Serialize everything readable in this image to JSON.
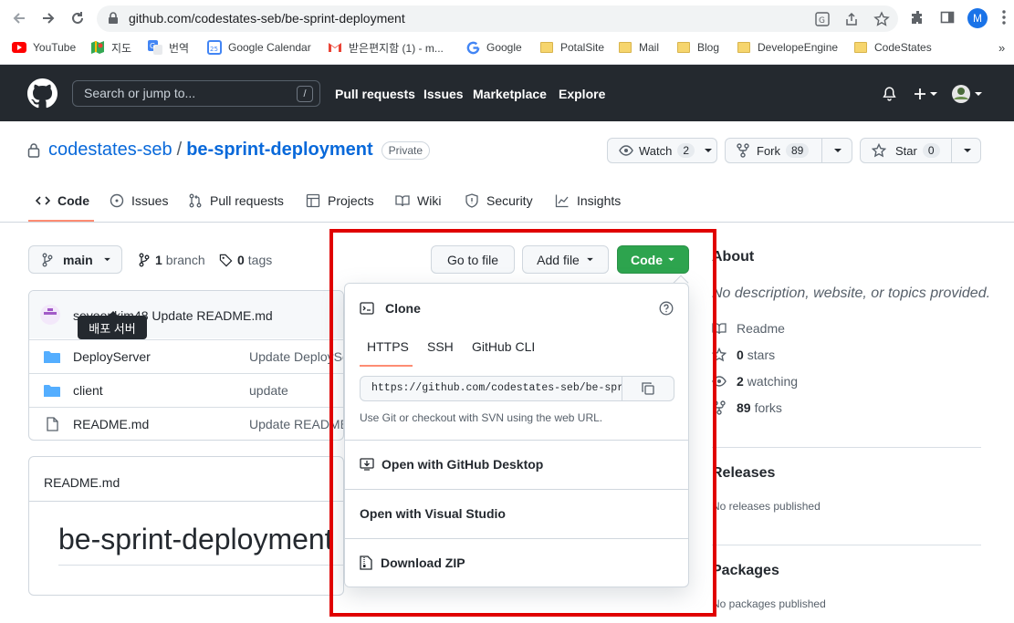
{
  "browser": {
    "url": "github.com/codestates-seb/be-sprint-deployment",
    "profile_initial": "M",
    "bookmarks": [
      "YouTube",
      "지도",
      "번역",
      "Google Calendar",
      "받은편지함 (1) - m...",
      "Google",
      "PotalSite",
      "Mail",
      "Blog",
      "DevelopeEngine",
      "CodeStates"
    ],
    "bookmarks_more": "»"
  },
  "header": {
    "search_placeholder": "Search or jump to...",
    "search_key": "/",
    "nav": [
      "Pull requests",
      "Issues",
      "Marketplace",
      "Explore"
    ]
  },
  "repo": {
    "owner": "codestates-seb",
    "separator": "/",
    "name": "be-sprint-deployment",
    "visibility": "Private",
    "watch_label": "Watch",
    "watch_count": "2",
    "fork_label": "Fork",
    "fork_count": "89",
    "star_label": "Star",
    "star_count": "0"
  },
  "tabs": [
    "Code",
    "Issues",
    "Pull requests",
    "Projects",
    "Wiki",
    "Security",
    "Insights"
  ],
  "toolbar": {
    "branch": "main",
    "branch_count": "1",
    "branch_label": "branch",
    "tag_count": "0",
    "tag_label": "tags",
    "go_to_file": "Go to file",
    "add_file": "Add file",
    "code": "Code"
  },
  "commit": {
    "author": "seyoonkim48",
    "message": "Update README.md"
  },
  "tooltip": "배포 서버",
  "files": [
    {
      "name": "DeployServer",
      "message": "Update DeploySe",
      "type": "folder"
    },
    {
      "name": "client",
      "message": "update",
      "type": "folder"
    },
    {
      "name": "README.md",
      "message": "Update README.",
      "type": "file"
    }
  ],
  "readme": {
    "label": "README.md",
    "heading": "be-sprint-deployment"
  },
  "about": {
    "title": "About",
    "description": "No description, website, or topics provided.",
    "readme": "Readme",
    "stars_count": "0",
    "stars_label": "stars",
    "watching_count": "2",
    "watching_label": "watching",
    "forks_count": "89",
    "forks_label": "forks",
    "releases_title": "Releases",
    "releases_text": "No releases published",
    "packages_title": "Packages",
    "packages_text": "No packages published"
  },
  "clone": {
    "title": "Clone",
    "tabs": [
      "HTTPS",
      "SSH",
      "GitHub CLI"
    ],
    "active_tab": "HTTPS",
    "url": "https://github.com/codestates-seb/be-sprint-deployment.git",
    "hint": "Use Git or checkout with SVN using the web URL.",
    "open_desktop": "Open with GitHub Desktop",
    "open_vs": "Open with Visual Studio",
    "download_zip": "Download ZIP"
  },
  "colors": {
    "header_bg": "#24292f",
    "link": "#0969da",
    "code_button": "#2da44e",
    "highlight": "#e00000",
    "active_tab": "#fd8c73"
  }
}
